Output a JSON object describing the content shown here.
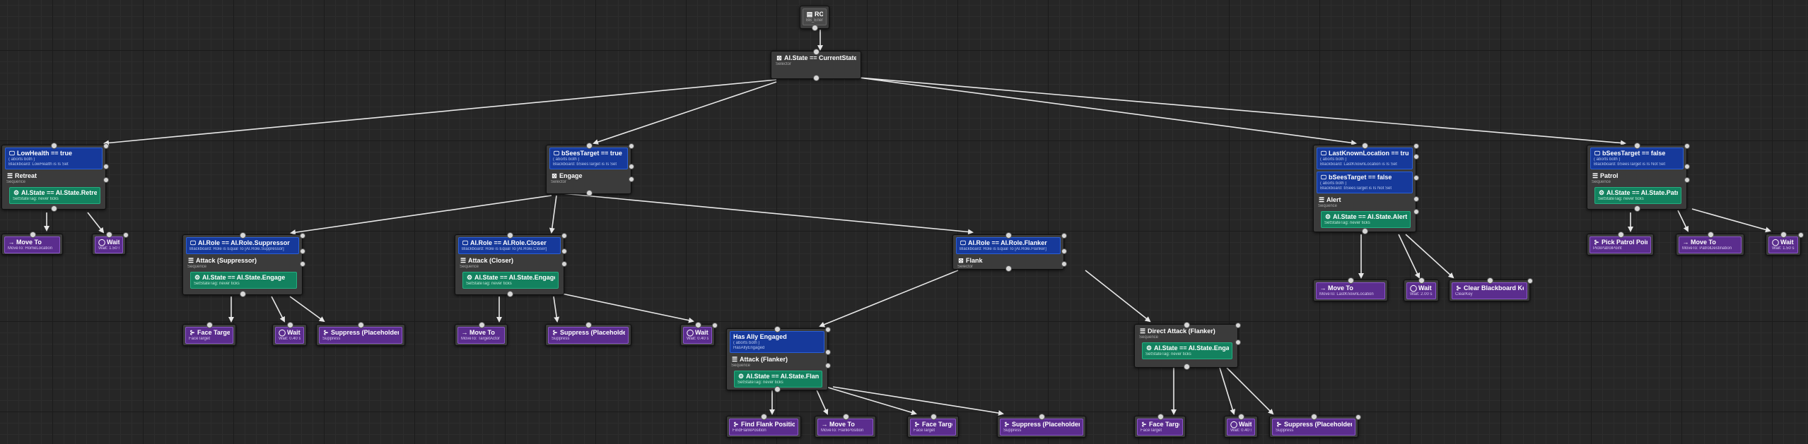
{
  "icons": {
    "decorator": "monitor-icon",
    "composite": "list-icon",
    "selector": "selector-icon",
    "service": "service-icon",
    "move": "arrow-right-icon",
    "wait": "clock-icon",
    "task": "task-icon"
  },
  "colors": {
    "decorator": "#16399b",
    "service": "#13825f",
    "task": "#5b2d8e",
    "node": "#3b3b3b",
    "wire": "#e8e8e8",
    "background": "#262626"
  },
  "root": {
    "title": "ROOT",
    "subtitle": "BB_Enemy"
  },
  "state_selector": {
    "title": "AI.State == CurrentState",
    "subtitle": "Selector"
  },
  "retreat": {
    "decorator": {
      "title": "LowHealth == true",
      "line1": "( aborts both )",
      "line2": "Blackboard: LowHealth is Is Set"
    },
    "composite": {
      "title": "Retreat",
      "subtitle": "Sequence"
    },
    "service": {
      "title": "AI.State == AI.State.Retreat",
      "subtitle": "SetStateTag: never ticks"
    },
    "tasks": [
      {
        "title": "Move To",
        "subtitle": "MoveTo: HomeLocation"
      },
      {
        "title": "Wait",
        "subtitle": "Wait: 1.50 s"
      }
    ]
  },
  "engage": {
    "decorator": {
      "title": "bSeesTarget == true",
      "line1": "( aborts both )",
      "line2": "Blackboard: bSeesTarget is Is Set"
    },
    "composite": {
      "title": "Engage",
      "subtitle": "Selector"
    }
  },
  "suppressor": {
    "decorator": {
      "title": "AI.Role == AI.Role.Suppressor",
      "line1": "Blackboard: Role is Equal To [AI.Role.Suppressor]"
    },
    "composite": {
      "title": "Attack (Suppressor)",
      "subtitle": "Sequence"
    },
    "service": {
      "title": "AI.State == AI.State.Engage",
      "subtitle": "SetStateTag: never ticks"
    },
    "tasks": [
      {
        "title": "Face Target",
        "subtitle": "FaceTarget"
      },
      {
        "title": "Wait",
        "subtitle": "Wait: 0.40 s"
      },
      {
        "title": "Suppress (Placeholder)",
        "subtitle": "Suppress"
      }
    ]
  },
  "closer": {
    "decorator": {
      "title": "AI.Role == AI.Role.Closer",
      "line1": "Blackboard: Role is Equal To [AI.Role.Closer]"
    },
    "composite": {
      "title": "Attack (Closer)",
      "subtitle": "Sequence"
    },
    "service": {
      "title": "AI.State == AI.State.Engage",
      "subtitle": "SetStateTag: never ticks"
    },
    "tasks": [
      {
        "title": "Move To",
        "subtitle": "MoveTo: TargetActor"
      },
      {
        "title": "Suppress (Placeholder)",
        "subtitle": "Suppress"
      },
      {
        "title": "Wait",
        "subtitle": "Wait: 0.40 s"
      }
    ]
  },
  "flanker": {
    "decorator": {
      "title": "AI.Role == AI.Role.Flanker",
      "line1": "Blackboard: Role is Equal To [AI.Role.Flanker]"
    },
    "composite": {
      "title": "Flank",
      "subtitle": "Selector"
    }
  },
  "ally_engaged": {
    "decorator": {
      "title": "Has Ally Engaged",
      "line1": "( aborts both )",
      "line2": "HasAllyEngaged"
    },
    "composite": {
      "title": "Attack (Flanker)",
      "subtitle": "Sequence"
    },
    "service": {
      "title": "AI.State == AI.State.Flank",
      "subtitle": "SetStateTag: never ticks"
    },
    "tasks": [
      {
        "title": "Find Flank Position",
        "subtitle": "FindFlankPosition"
      },
      {
        "title": "Move To",
        "subtitle": "MoveTo: FlankPosition"
      },
      {
        "title": "Face Target",
        "subtitle": "FaceTarget"
      },
      {
        "title": "Suppress (Placeholder)",
        "subtitle": "Suppress"
      }
    ]
  },
  "direct_attack": {
    "composite": {
      "title": "Direct Attack (Flanker)",
      "subtitle": "Sequence"
    },
    "service": {
      "title": "AI.State == AI.State.Engage",
      "subtitle": "SetStateTag: never ticks"
    },
    "tasks": [
      {
        "title": "Face Target",
        "subtitle": "FaceTarget"
      },
      {
        "title": "Wait",
        "subtitle": "Wait: 0.40 s"
      },
      {
        "title": "Suppress (Placeholder)",
        "subtitle": "Suppress"
      }
    ]
  },
  "alert": {
    "decorator1": {
      "title": "LastKnownLocation == true",
      "line1": "( aborts both )",
      "line2": "Blackboard: LastKnownLocation is Is Set"
    },
    "decorator2": {
      "title": "bSeesTarget == false",
      "line1": "( aborts both )",
      "line2": "Blackboard: bSeesTarget is Is Not Set"
    },
    "composite": {
      "title": "Alert",
      "subtitle": "Sequence"
    },
    "service": {
      "title": "AI.State == AI.State.Alert",
      "subtitle": "SetStateTag: never ticks"
    },
    "tasks": [
      {
        "title": "Move To",
        "subtitle": "MoveTo: LastKnownLocation"
      },
      {
        "title": "Wait",
        "subtitle": "Wait: 2.00 s"
      },
      {
        "title": "Clear Blackboard Key",
        "subtitle": "ClearKey"
      }
    ]
  },
  "patrol": {
    "decorator": {
      "title": "bSeesTarget == false",
      "line1": "( aborts both )",
      "line2": "Blackboard: bSeesTarget is Is Not Set"
    },
    "composite": {
      "title": "Patrol",
      "subtitle": "Sequence"
    },
    "service": {
      "title": "AI.State == AI.State.Patrol",
      "subtitle": "SetStateTag: never ticks"
    },
    "tasks": [
      {
        "title": "Pick Patrol Point",
        "subtitle": "PickPatrolPoint"
      },
      {
        "title": "Move To",
        "subtitle": "MoveTo: PatrolDestination"
      },
      {
        "title": "Wait",
        "subtitle": "Wait: 1.50 s"
      }
    ]
  }
}
